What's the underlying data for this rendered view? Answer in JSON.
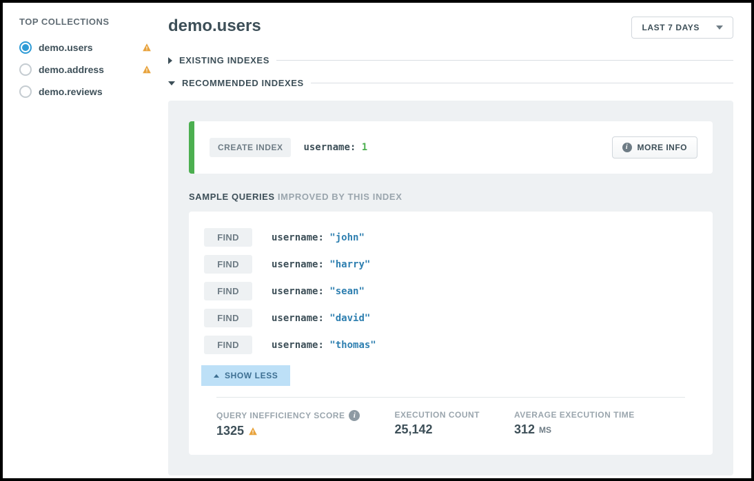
{
  "sidebar": {
    "title": "TOP COLLECTIONS",
    "items": [
      {
        "label": "demo.users",
        "selected": true,
        "warn": true
      },
      {
        "label": "demo.address",
        "selected": false,
        "warn": true
      },
      {
        "label": "demo.reviews",
        "selected": false,
        "warn": false
      }
    ]
  },
  "header": {
    "title": "demo.users",
    "date_range": "LAST 7 DAYS"
  },
  "sections": {
    "existing": "EXISTING INDEXES",
    "recommended": "RECOMMENDED INDEXES"
  },
  "create_index": {
    "chip": "CREATE INDEX",
    "field": "username",
    "value": "1",
    "more_info": "MORE INFO"
  },
  "sample": {
    "title": "SAMPLE QUERIES",
    "subtitle": "IMPROVED BY THIS INDEX",
    "find_label": "FIND",
    "field": "username",
    "queries": [
      "\"john\"",
      "\"harry\"",
      "\"sean\"",
      "\"david\"",
      "\"thomas\""
    ],
    "show_less": "SHOW LESS"
  },
  "stats": {
    "inefficiency_label": "QUERY INEFFICIENCY SCORE",
    "inefficiency_value": "1325",
    "exec_count_label": "EXECUTION COUNT",
    "exec_count_value": "25,142",
    "avg_time_label": "AVERAGE EXECUTION TIME",
    "avg_time_value": "312",
    "avg_time_unit": "MS"
  }
}
